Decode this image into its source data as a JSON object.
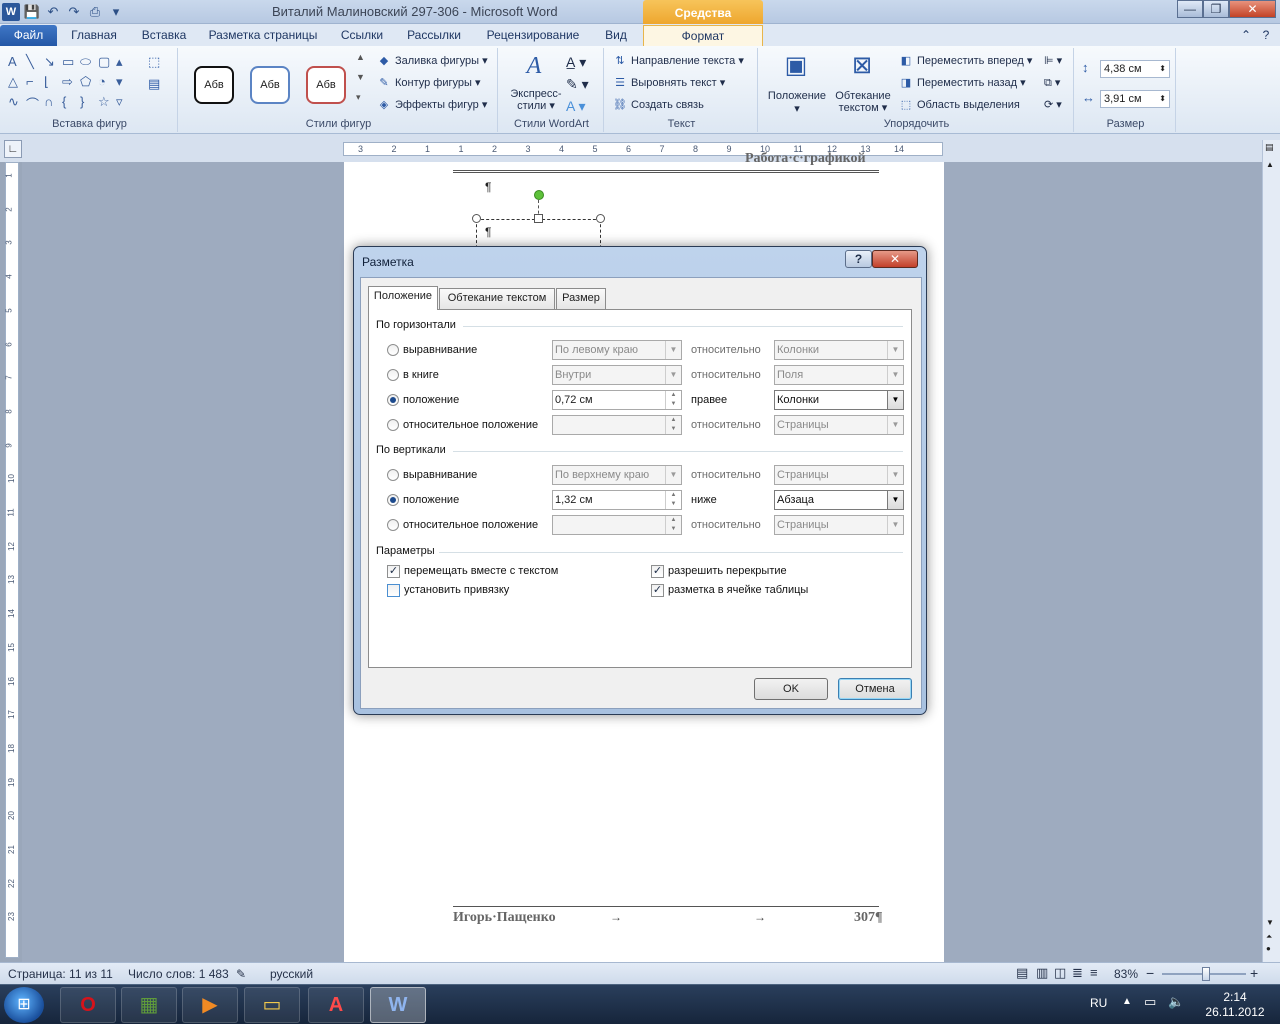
{
  "window": {
    "title": "Виталий Малиновский 297-306  -  Microsoft Word",
    "context_tab_header": "Средства рисования",
    "min_glyph": "—",
    "max_glyph": "❐",
    "close_glyph": "✕"
  },
  "ribbon_tabs": [
    {
      "label": "Файл"
    },
    {
      "label": "Главная"
    },
    {
      "label": "Вставка"
    },
    {
      "label": "Разметка страницы"
    },
    {
      "label": "Ссылки"
    },
    {
      "label": "Рассылки"
    },
    {
      "label": "Рецензирование"
    },
    {
      "label": "Вид"
    },
    {
      "label": "Формат"
    }
  ],
  "ribbon": {
    "insert_shapes": {
      "label": "Вставка фигур"
    },
    "shape_styles": {
      "label": "Стили фигур",
      "style_sample": "Абв",
      "fill": "Заливка фигуры",
      "outline": "Контур фигуры",
      "effects": "Эффекты фигур"
    },
    "wordart": {
      "label": "Стили WordArt",
      "express_line1": "Экспресс-",
      "express_line2": "стили"
    },
    "text": {
      "label": "Текст",
      "direction": "Направление текста",
      "align": "Выровнять текст",
      "link": "Создать связь"
    },
    "arrange": {
      "label": "Упорядочить",
      "position": "Положение",
      "wrap_line1": "Обтекание",
      "wrap_line2": "текстом",
      "bring_forward": "Переместить вперед",
      "send_backward": "Переместить назад",
      "selection_pane": "Область выделения"
    },
    "size": {
      "label": "Размер",
      "height": "4,38 см",
      "width": "3,91 см"
    }
  },
  "ruler": {
    "h_ticks": [
      "3",
      "2",
      "1",
      "1",
      "2",
      "3",
      "4",
      "5",
      "6",
      "7",
      "8",
      "9",
      "10",
      "11",
      "12",
      "13",
      "14"
    ],
    "v_ticks": [
      "1",
      "2",
      "3",
      "4",
      "5",
      "6",
      "7",
      "8",
      "9",
      "10",
      "11",
      "12",
      "13",
      "14",
      "15",
      "16",
      "17",
      "18",
      "19",
      "20",
      "21",
      "22",
      "23"
    ]
  },
  "document": {
    "header_text": "Работа·с·графикой",
    "pilcrow": "¶",
    "footer_author": "Игорь·Пащенко",
    "footer_page": "307¶",
    "tab_arrow": "→"
  },
  "dialog": {
    "title": "Разметка",
    "help": "?",
    "close": "✕",
    "tabs": [
      {
        "label": "Положение",
        "active": true
      },
      {
        "label": "Обтекание текстом",
        "active": false
      },
      {
        "label": "Размер",
        "active": false
      }
    ],
    "horizontal": {
      "heading": "По горизонтали",
      "rows": [
        {
          "label": "выравнивание",
          "selected": false,
          "value": "По левому краю",
          "relation": "относительно",
          "relative_to": "Колонки"
        },
        {
          "label": "в книге",
          "selected": false,
          "value": "Внутри",
          "relation": "относительно",
          "relative_to": "Поля"
        },
        {
          "label": "положение",
          "selected": true,
          "value": "0,72 см",
          "relation": "правее",
          "relative_to": "Колонки"
        },
        {
          "label": "относительное положение",
          "selected": false,
          "value": "",
          "relation": "относительно",
          "relative_to": "Страницы"
        }
      ]
    },
    "vertical": {
      "heading": "По вертикали",
      "rows": [
        {
          "label": "выравнивание",
          "selected": false,
          "value": "По верхнему краю",
          "relation": "относительно",
          "relative_to": "Страницы"
        },
        {
          "label": "положение",
          "selected": true,
          "value": "1,32 см",
          "relation": "ниже",
          "relative_to": "Абзаца"
        },
        {
          "label": "относительное положение",
          "selected": false,
          "value": "",
          "relation": "относительно",
          "relative_to": "Страницы"
        }
      ]
    },
    "options": {
      "heading": "Параметры",
      "move_with_text": {
        "label": "перемещать вместе с текстом",
        "checked": true
      },
      "lock_anchor": {
        "label": "установить привязку",
        "checked": false
      },
      "allow_overlap": {
        "label": "разрешить перекрытие",
        "checked": true
      },
      "layout_in_cell": {
        "label": "разметка в ячейке таблицы",
        "checked": true
      }
    },
    "ok": "OK",
    "cancel": "Отмена",
    "check_glyph": "✓",
    "dropdown_glyph": "▼",
    "spin_glyph_up": "▲",
    "spin_glyph_down": "▼"
  },
  "statusbar": {
    "page": "Страница: 11 из 11",
    "words": "Число слов: 1 483",
    "language": "русский",
    "zoom": "83%",
    "zoom_out": "−",
    "zoom_in": "+",
    "zoom_level": 0.52
  },
  "taskbar": {
    "apps": [
      {
        "name": "opera",
        "glyph": "O",
        "color": "#d6131b"
      },
      {
        "name": "minecraft",
        "glyph": "▦",
        "color": "#5f9b3b"
      },
      {
        "name": "media-player",
        "glyph": "▶",
        "color": "#f08a24"
      },
      {
        "name": "explorer",
        "glyph": "▭",
        "color": "#f2c94c"
      },
      {
        "name": "acrobat",
        "glyph": "A",
        "color": "#c1121c"
      },
      {
        "name": "word",
        "glyph": "W",
        "color": "#2b579a"
      }
    ],
    "language": "RU",
    "time": "2:14",
    "date": "26.11.2012"
  }
}
